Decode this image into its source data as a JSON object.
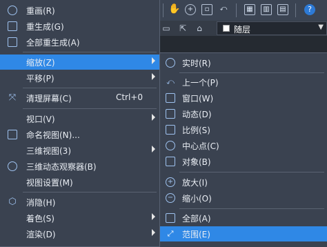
{
  "toolbar": {
    "layer_name": "随层"
  },
  "menu": {
    "items": [
      {
        "label": "重画(R)",
        "icon": "redraw-icon"
      },
      {
        "label": "重生成(G)",
        "icon": "regen-icon"
      },
      {
        "label": "全部重生成(A)",
        "icon": "regen-all-icon"
      },
      {
        "label": "缩放(Z)",
        "icon": "",
        "submenu": true,
        "highlighted": true
      },
      {
        "label": "平移(P)",
        "icon": "",
        "submenu": true
      },
      {
        "label": "清理屏幕(C)",
        "shortcut": "Ctrl+0",
        "icon": "clean-screen-icon"
      },
      {
        "label": "视口(V)",
        "icon": "",
        "submenu": true
      },
      {
        "label": "命名视图(N)...",
        "icon": "named-views-icon"
      },
      {
        "label": "三维视图(3)",
        "icon": "",
        "submenu": true
      },
      {
        "label": "三维动态观察器(B)",
        "icon": "3d-orbit-icon"
      },
      {
        "label": "视图设置(M)",
        "icon": ""
      },
      {
        "label": "消隐(H)",
        "icon": "hide-icon"
      },
      {
        "label": "着色(S)",
        "icon": "",
        "submenu": true
      },
      {
        "label": "渲染(D)",
        "icon": "",
        "submenu": true
      }
    ]
  },
  "zoom_submenu": {
    "items": [
      {
        "label": "实时(R)",
        "icon": "zoom-realtime-icon"
      },
      {
        "label": "上一个(P)",
        "icon": "zoom-previous-icon"
      },
      {
        "label": "窗口(W)",
        "icon": "zoom-window-icon"
      },
      {
        "label": "动态(D)",
        "icon": "zoom-dynamic-icon"
      },
      {
        "label": "比例(S)",
        "icon": "zoom-scale-icon"
      },
      {
        "label": "中心点(C)",
        "icon": "zoom-center-icon"
      },
      {
        "label": "对象(B)",
        "icon": "zoom-object-icon"
      },
      {
        "label": "放大(I)",
        "icon": "zoom-in-icon"
      },
      {
        "label": "缩小(O)",
        "icon": "zoom-out-icon"
      },
      {
        "label": "全部(A)",
        "icon": "zoom-all-icon"
      },
      {
        "label": "范围(E)",
        "icon": "zoom-extents-icon",
        "highlighted": true
      }
    ]
  },
  "colors": {
    "menu_bg": "#3a4250",
    "highlight": "#2f88e6",
    "canvas": "#252a31"
  }
}
